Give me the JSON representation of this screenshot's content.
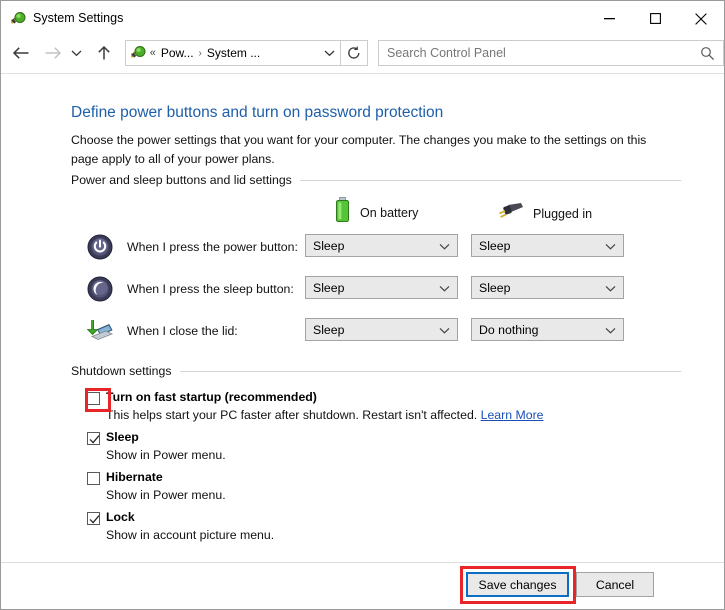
{
  "window": {
    "title": "System Settings",
    "icon": "power-plug-icon",
    "behind_sliver_text": "•••••••• ••••••• •••• •••••• •••••",
    "controls": {
      "minimize": "minimize-icon",
      "maximize": "maximize-icon",
      "close": "close-icon"
    }
  },
  "nav": {
    "back": "back-arrow-icon",
    "forward": "forward-arrow-icon",
    "recent": "recent-locations-icon",
    "up": "up-arrow-icon",
    "address": {
      "icon": "power-plug-icon",
      "overflow": "«",
      "crumb1": "Pow...",
      "separator": "›",
      "crumb2": "System ...",
      "dropdown": "chevron-down-icon"
    },
    "refresh": "refresh-icon",
    "search": {
      "placeholder": "Search Control Panel",
      "value": "",
      "icon": "search-icon"
    }
  },
  "page": {
    "heading": "Define power buttons and turn on password protection",
    "description": "Choose the power settings that you want for your computer. The changes you make to the settings on this page apply to all of your power plans."
  },
  "power_section": {
    "group_label": "Power and sleep buttons and lid settings",
    "columns": [
      {
        "label": "On battery",
        "icon": "battery-icon"
      },
      {
        "label": "Plugged in",
        "icon": "power-plug-icon"
      }
    ],
    "rows": [
      {
        "icon": "power-button-icon",
        "label": "When I press the power button:",
        "on_battery": "Sleep",
        "plugged_in": "Sleep"
      },
      {
        "icon": "sleep-moon-icon",
        "label": "When I press the sleep button:",
        "on_battery": "Sleep",
        "plugged_in": "Sleep"
      },
      {
        "icon": "close-lid-laptop-icon",
        "label": "When I close the lid:",
        "on_battery": "Sleep",
        "plugged_in": "Do nothing"
      }
    ]
  },
  "shutdown_section": {
    "group_label": "Shutdown settings",
    "items": [
      {
        "label": "Turn on fast startup (recommended)",
        "checked": false,
        "desc_before": "This helps start your PC faster after shutdown. Restart isn't affected. ",
        "link": "Learn More",
        "highlighted": true
      },
      {
        "label": "Sleep",
        "checked": true,
        "desc_before": "Show in Power menu.",
        "link": "",
        "highlighted": false
      },
      {
        "label": "Hibernate",
        "checked": false,
        "desc_before": "Show in Power menu.",
        "link": "",
        "highlighted": false
      },
      {
        "label": "Lock",
        "checked": true,
        "desc_before": "Show in account picture menu.",
        "link": "",
        "highlighted": false
      }
    ]
  },
  "footer": {
    "save_label": "Save changes",
    "cancel_label": "Cancel",
    "save_highlighted": true
  },
  "colors": {
    "heading_blue": "#1e5fa8",
    "link_blue": "#1a4fba",
    "annotation_red": "#e8262a",
    "focus_blue": "#0a6fc2",
    "control_face": "#e9e9e9",
    "control_border": "#a3a3a3"
  }
}
